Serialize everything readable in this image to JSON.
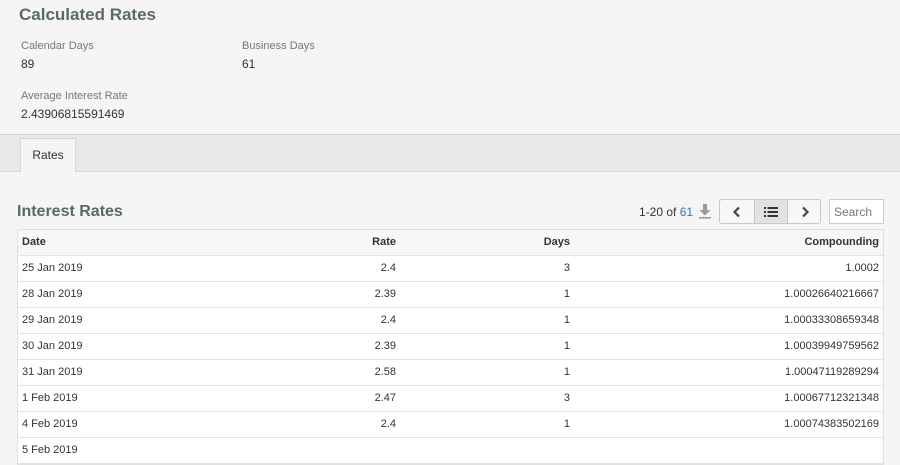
{
  "summary": {
    "title": "Calculated Rates",
    "calendar_days_label": "Calendar Days",
    "calendar_days_value": "89",
    "business_days_label": "Business Days",
    "business_days_value": "61",
    "avg_rate_label": "Average Interest Rate",
    "avg_rate_value": "2.43906815591469"
  },
  "tabs": [
    {
      "label": "Rates"
    }
  ],
  "panel": {
    "title": "Interest Rates",
    "range": "1-20 of ",
    "total": "61",
    "search_placeholder": "Search"
  },
  "table": {
    "headers": [
      "Date",
      "Rate",
      "Days",
      "Compounding"
    ],
    "rows": [
      [
        "25 Jan 2019",
        "2.4",
        "3",
        "1.0002"
      ],
      [
        "28 Jan 2019",
        "2.39",
        "1",
        "1.00026640216667"
      ],
      [
        "29 Jan 2019",
        "2.4",
        "1",
        "1.00033308659348"
      ],
      [
        "30 Jan 2019",
        "2.39",
        "1",
        "1.00039949759562"
      ],
      [
        "31 Jan 2019",
        "2.58",
        "1",
        "1.00047119289294"
      ],
      [
        "1 Feb 2019",
        "2.47",
        "3",
        "1.00067712321348"
      ],
      [
        "4 Feb 2019",
        "2.4",
        "1",
        "1.00074383502169"
      ],
      [
        "5 Feb 2019",
        "",
        "",
        ""
      ]
    ]
  },
  "icons": {
    "download": "download-icon",
    "prev": "chevron-left-icon",
    "list": "list-icon",
    "next": "chevron-right-icon"
  },
  "colors": {
    "title": "#5a6a6a",
    "link": "#2a7ab8",
    "background": "#f5f5f5"
  }
}
